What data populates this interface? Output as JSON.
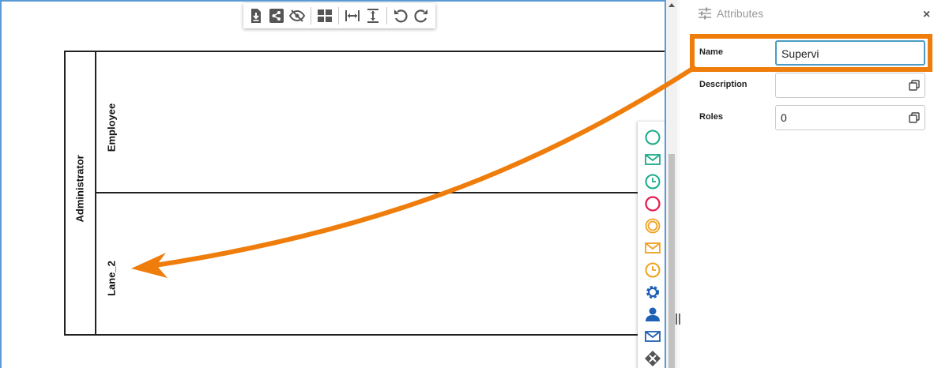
{
  "toolbar": {
    "items": [
      {
        "name": "export-icon"
      },
      {
        "name": "share-icon"
      },
      {
        "name": "hide-icon"
      },
      {
        "name": "grid-layout-icon"
      },
      {
        "name": "fit-width-icon"
      },
      {
        "name": "fit-height-icon"
      },
      {
        "name": "undo-icon"
      },
      {
        "name": "redo-icon"
      }
    ]
  },
  "diagram": {
    "pool_label": "Administrator",
    "lanes": [
      {
        "label": "Employee"
      },
      {
        "label": "Lane_2"
      }
    ]
  },
  "palette": {
    "items": [
      {
        "name": "start-event-icon",
        "color": "#1aab8a"
      },
      {
        "name": "start-message-event-icon",
        "color": "#1aab8a"
      },
      {
        "name": "start-timer-event-icon",
        "color": "#1aab8a"
      },
      {
        "name": "end-event-icon",
        "color": "#e4194d"
      },
      {
        "name": "intermediate-event-icon",
        "color": "#f0a020"
      },
      {
        "name": "intermediate-message-event-icon",
        "color": "#f0a020"
      },
      {
        "name": "intermediate-timer-event-icon",
        "color": "#f0a020"
      },
      {
        "name": "service-task-icon",
        "color": "#1f5fb4"
      },
      {
        "name": "user-task-icon",
        "color": "#1f5fb4"
      },
      {
        "name": "message-task-icon",
        "color": "#1f5fb4"
      },
      {
        "name": "exclusive-gateway-icon",
        "color": "#555555"
      }
    ]
  },
  "panel": {
    "title": "Attributes",
    "close": "×",
    "fields": {
      "name": {
        "label": "Name",
        "value": "Supervi"
      },
      "description": {
        "label": "Description",
        "value": ""
      },
      "roles": {
        "label": "Roles",
        "value": "0"
      }
    }
  },
  "colors": {
    "annotation": "#ef7d0c",
    "canvas_border": "#5b9bd5",
    "toolbar_icon": "#555555"
  }
}
